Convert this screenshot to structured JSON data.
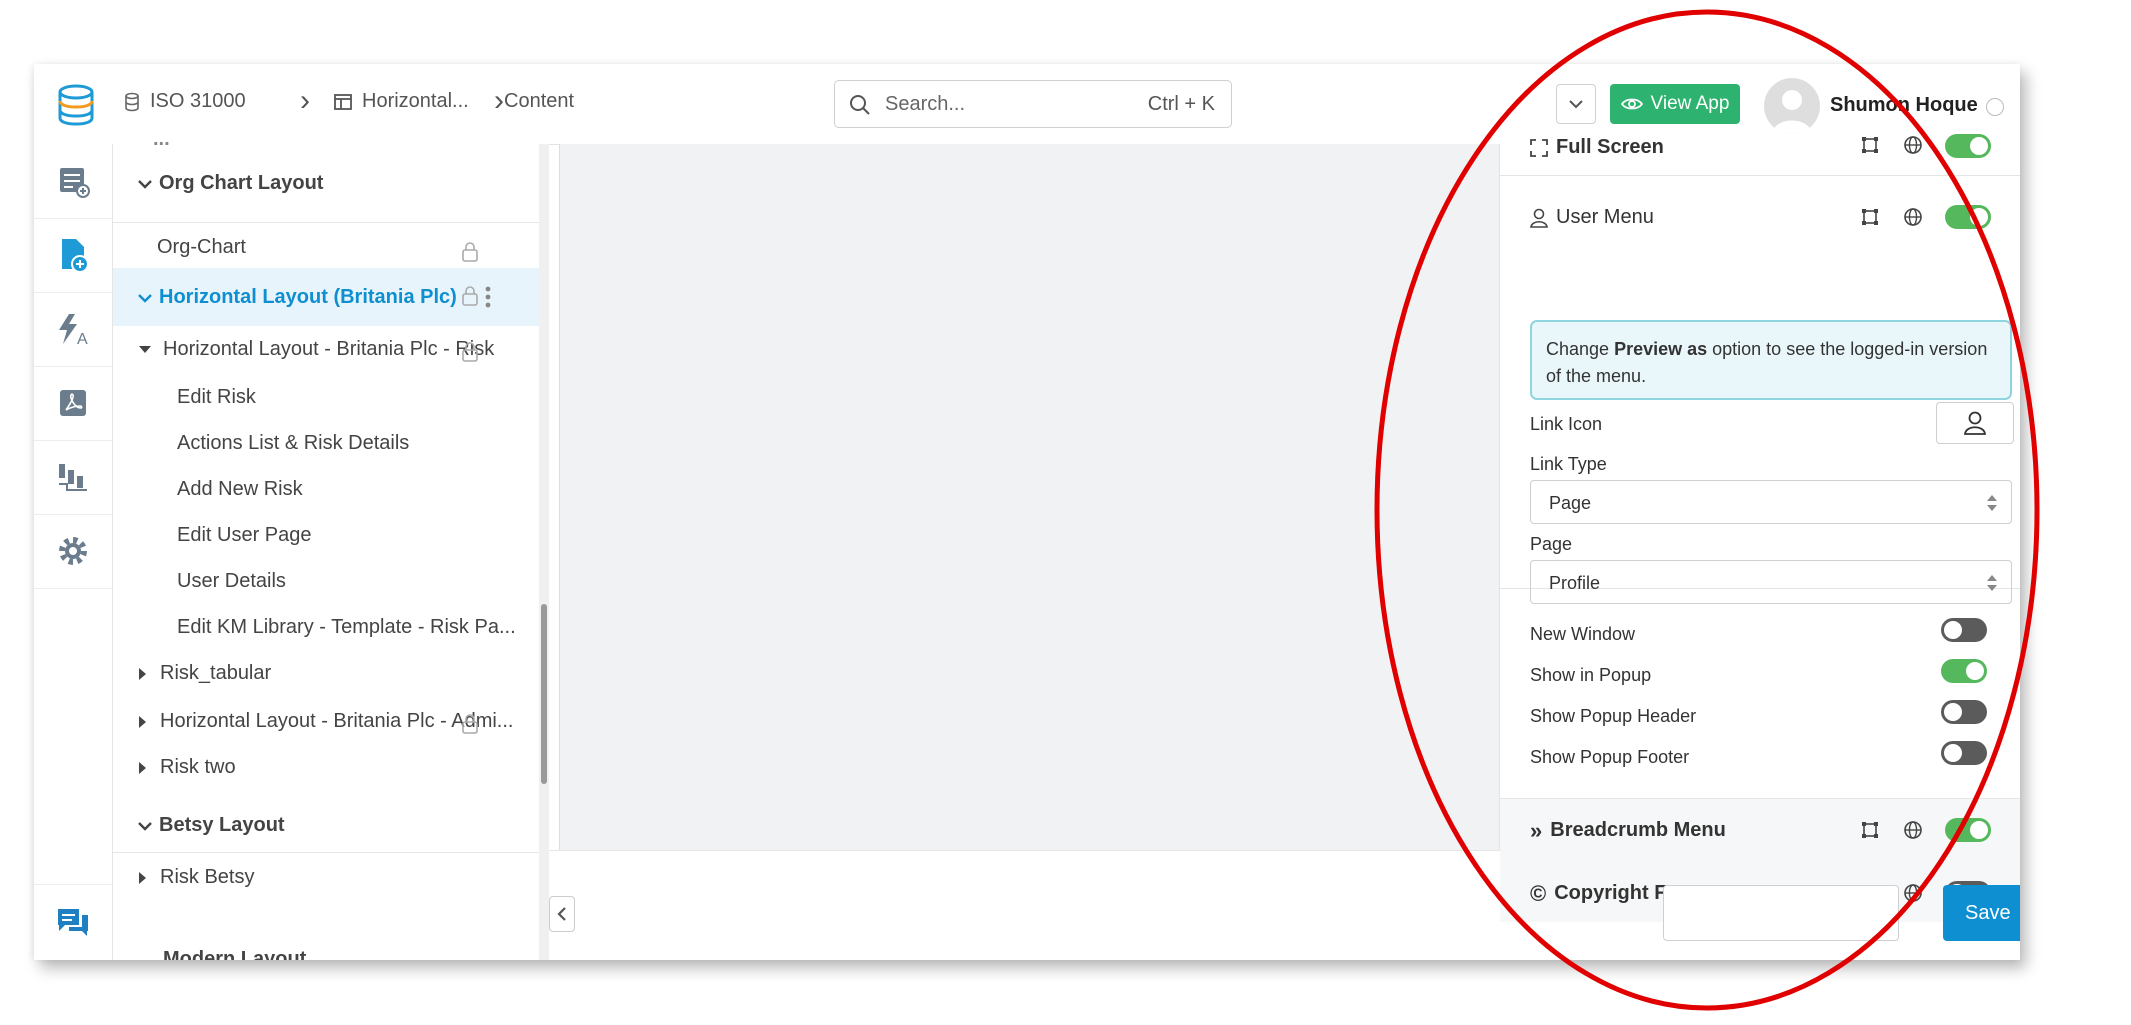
{
  "breadcrumb": {
    "db": "ISO 31000",
    "layout": "Horizontal...",
    "content": "Content"
  },
  "search": {
    "placeholder": "Search...",
    "shortcut": "Ctrl + K"
  },
  "header": {
    "view_app": "View App",
    "user_name": "Shumon Hoque"
  },
  "rail": [
    "add-page-icon",
    "page-editor-icon",
    "translation-icon",
    "pdf-icon",
    "workflow-icon",
    "gear-icon",
    "chat-icon"
  ],
  "tree": {
    "partial_top": "...",
    "org_chart_layout": "Org Chart Layout",
    "org_chart": "Org-Chart",
    "horizontal_layout": "Horizontal Layout (Britania Plc)",
    "risk_folder": "Horizontal Layout - Britania Plc - Risk",
    "pages": [
      "Edit Risk",
      "Actions List & Risk Details",
      "Add New Risk",
      "Edit User Page",
      "User Details",
      "Edit KM Library - Template - Risk Pa..."
    ],
    "risk_tabular": "Risk_tabular",
    "admin_folder": "Horizontal Layout - Britania Plc - Admi...",
    "risk_two": "Risk two",
    "betsy_layout": "Betsy Layout",
    "risk_betsy": "Risk Betsy",
    "partial_bottom": "Modern Layout"
  },
  "panel": {
    "full_screen": "Full Screen",
    "user_menu": "User Menu",
    "info_prefix": "Change ",
    "info_bold": "Preview as",
    "info_suffix": " option to see the logged-in version of the menu.",
    "link_icon": "Link Icon",
    "link_type_label": "Link Type",
    "link_type_value": "Page",
    "page_label": "Page",
    "page_value": "Profile",
    "new_window": "New Window",
    "show_in_popup": "Show in Popup",
    "show_popup_header": "Show Popup Header",
    "show_popup_footer": "Show Popup Footer",
    "breadcrumb_menu": "Breadcrumb Menu",
    "copyright_footer": "Copyright Footer"
  },
  "toggles": {
    "full_screen": true,
    "user_menu": true,
    "new_window": false,
    "show_in_popup": true,
    "show_popup_header": false,
    "show_popup_footer": false,
    "breadcrumb_menu": true,
    "copyright_footer": false
  },
  "footer": {
    "save": "Save"
  },
  "colors": {
    "accent": "#0e8fd2",
    "selected_bg": "#e8f4fb",
    "view_app": "#2db36f",
    "toggle_on": "#55b85c",
    "annotation": "#e00000"
  }
}
